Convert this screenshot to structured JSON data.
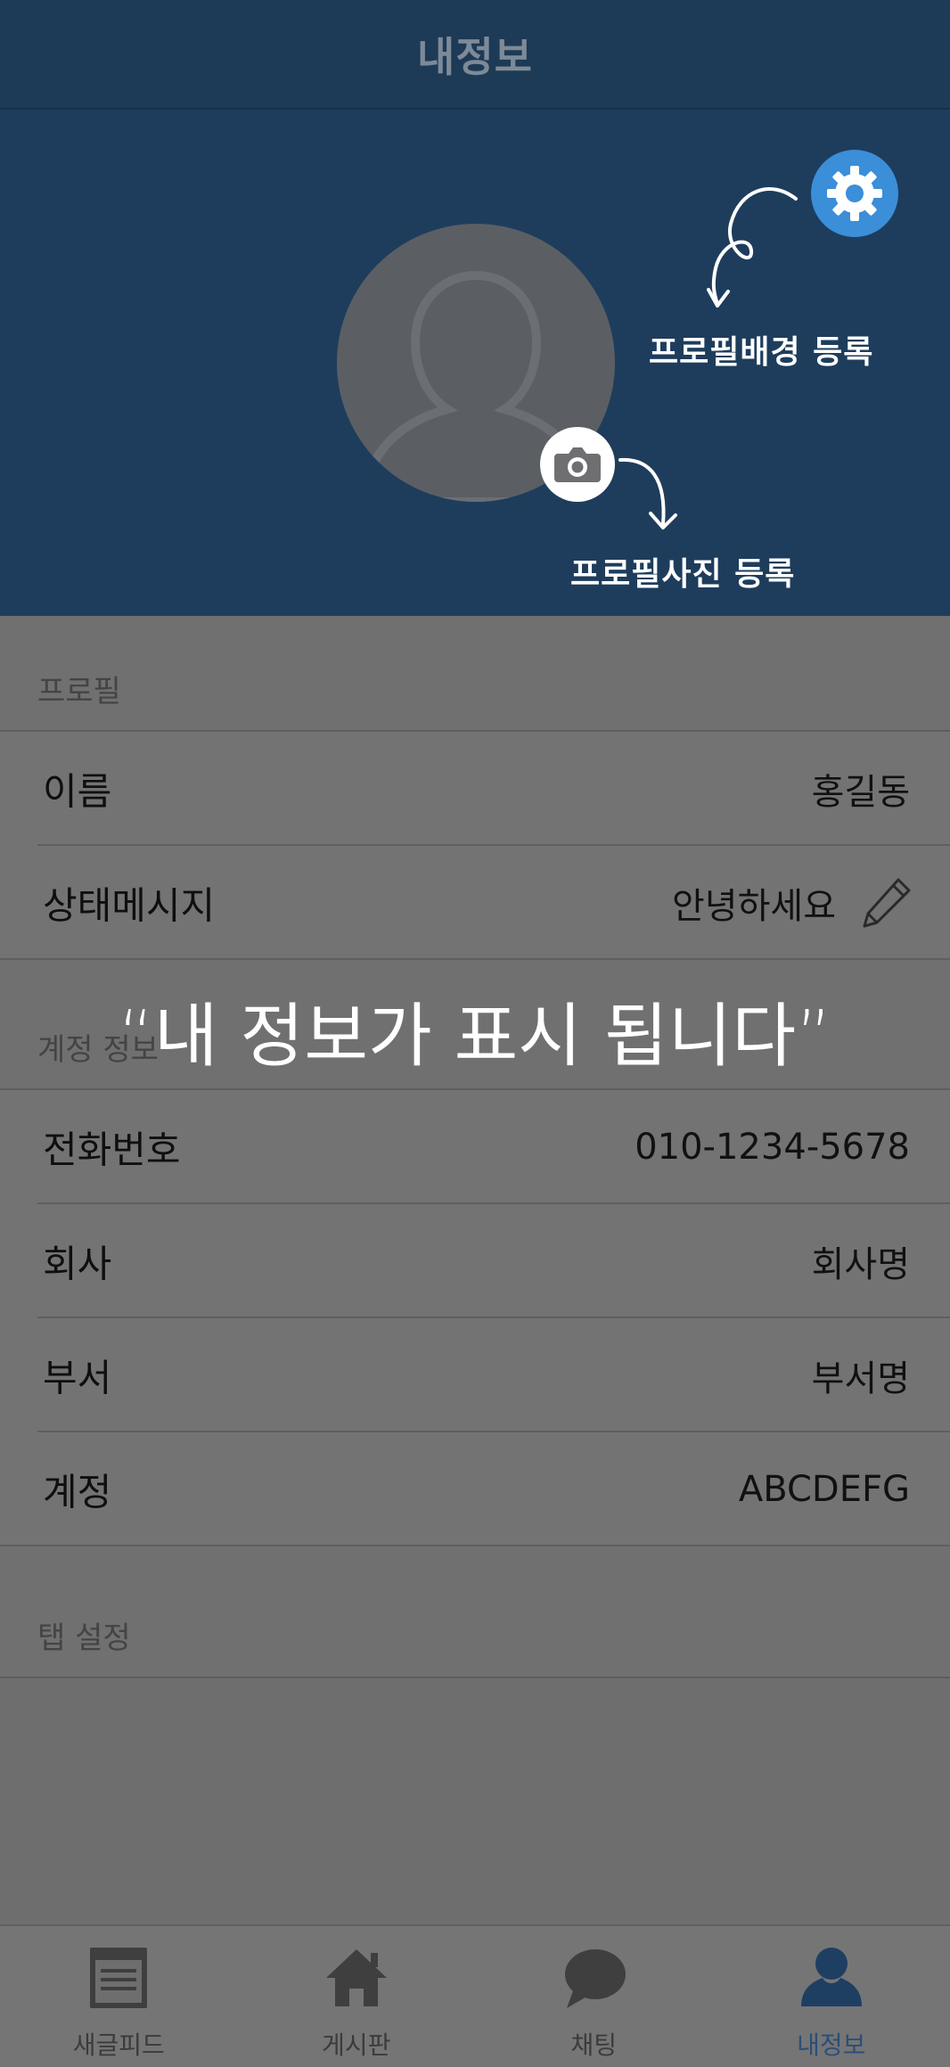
{
  "header": {
    "title": "내정보"
  },
  "hero": {
    "hint_background": "프로필배경 등록",
    "hint_photo": "프로필사진 등록",
    "gear_icon": "gear-icon",
    "camera_icon": "camera-icon"
  },
  "profile": {
    "section_label": "프로필",
    "rows": [
      {
        "key": "이름",
        "value": "홍길동"
      },
      {
        "key": "상태메시지",
        "value": "안녕하세요"
      }
    ]
  },
  "account": {
    "section_label": "계정 정보",
    "rows": [
      {
        "key": "전화번호",
        "value": "010-1234-5678"
      },
      {
        "key": "회사",
        "value": "회사명"
      },
      {
        "key": "부서",
        "value": "부서명"
      },
      {
        "key": "계정",
        "value": "ABCDEFG"
      }
    ]
  },
  "tab_settings": {
    "section_label": "탭 설정"
  },
  "overlay": {
    "caption": "“내 정보가 표시 됩니다”"
  },
  "tabbar": {
    "tabs": [
      {
        "label": "새글피드",
        "icon": "feed-icon"
      },
      {
        "label": "게시판",
        "icon": "home-icon"
      },
      {
        "label": "채팅",
        "icon": "chat-bubble-icon"
      },
      {
        "label": "내정보",
        "icon": "person-icon",
        "active": true
      }
    ]
  },
  "colors": {
    "header_bg": "#1d3a56",
    "hero_bg": "#1e3d5c",
    "accent": "#3b8ed8",
    "active_tab": "#2b4e77"
  }
}
